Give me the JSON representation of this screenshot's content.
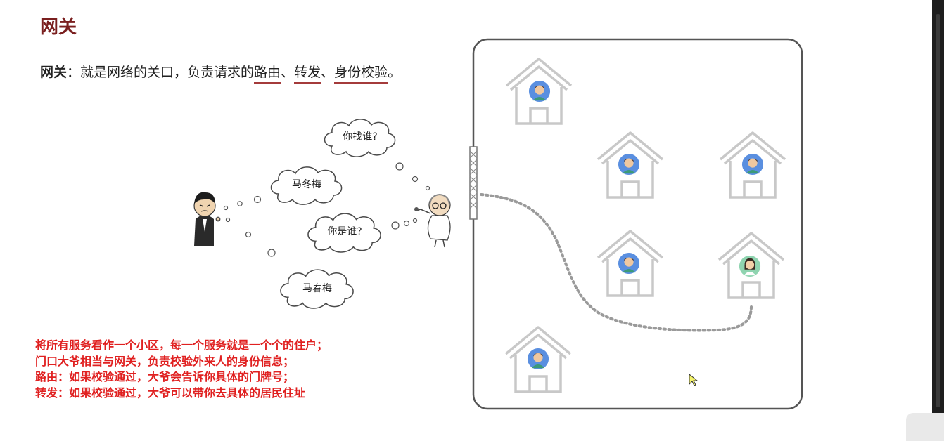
{
  "slide": {
    "title": "网关",
    "definition": {
      "term": "网关",
      "colon": "：",
      "text_prefix": "就是网络的关口，负责请求的",
      "kw1": "路由",
      "sep1": "、",
      "kw2": "转发",
      "sep2": "、",
      "kw3": "身份校验",
      "end": "。"
    }
  },
  "clouds": {
    "c1": "你找谁?",
    "c2": "马冬梅",
    "c3": "你是谁?",
    "c4": "马春梅"
  },
  "notes": [
    "将所有服务看作一个小区，每一个服务就是一个个的住户；",
    "门口大爷相当与网关，负责校验外来人的身份信息；",
    "路由：如果校验通过，大爷会告诉你具体的门牌号；",
    "转发：如果校验通过，大爷可以带你去具体的居民住址"
  ],
  "colors": {
    "title": "#7a1f1f",
    "underline": "#a43b3b",
    "notes": "#e02020",
    "avatar_bg": "#5a8fe0",
    "house_stroke": "#bdbdbd"
  },
  "icons": {
    "visitor": "visitor-figure",
    "gatekeeper": "old-man-figure",
    "gate": "gate-icon",
    "house": "house-icon",
    "cursor": "mouse-cursor-icon"
  }
}
